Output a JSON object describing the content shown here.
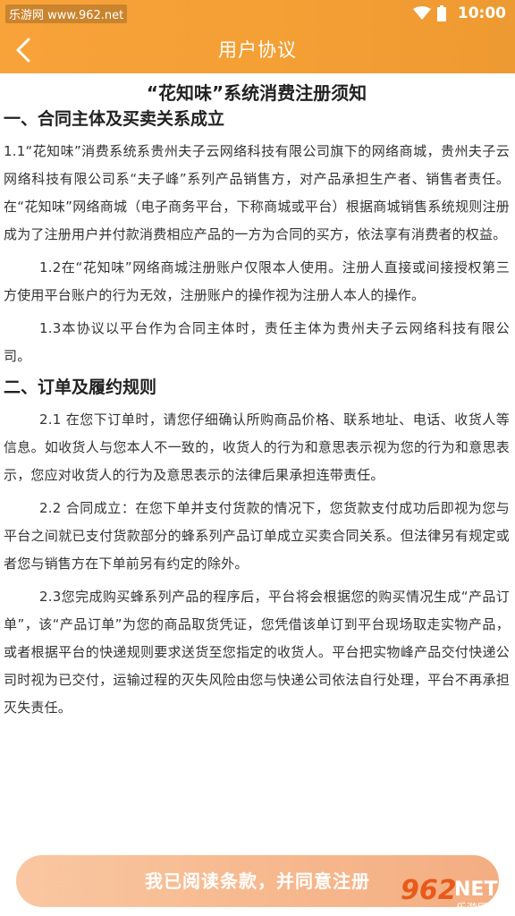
{
  "status_bar": {
    "watermark": "乐游网 www.962.net",
    "time": "10:00"
  },
  "header": {
    "title": "用户协议",
    "back_icon": "chevron-left-icon",
    "bg_color": "#f5a038"
  },
  "document": {
    "title": "“花知味”系统消费注册须知",
    "sections": [
      {
        "heading": "一、合同主体及买卖关系成立",
        "paragraphs": [
          "1.1“花知味”消费系统系贵州夫子云网络科技有限公司旗下的网络商城，贵州夫子云网络科技有限公司系“夫子峰”系列产品销售方，对产品承担生产者、销售者责任。在“花知味”网络商城（电子商务平台，下称商城或平台）根据商城销售系统规则注册成为了注册用户并付款消费相应产品的一方为合同的买方，依法享有消费者的权益。",
          "1.2在“花知味”网络商城注册账户仅限本人使用。注册人直接或间接授权第三方使用平台账户的行为无效，注册账户的操作视为注册人本人的操作。",
          "1.3本协议以平台作为合同主体时，责任主体为贵州夫子云网络科技有限公司。"
        ]
      },
      {
        "heading": "二、订单及履约规则",
        "paragraphs": [
          "2.1 在您下订单时，请您仔细确认所购商品价格、联系地址、电话、收货人等信息。如收货人与您本人不一致的，收货人的行为和意思表示视为您的行为和意思表示，您应对收货人的行为及意思表示的法律后果承担连带责任。",
          "2.2 合同成立：在您下单并支付货款的情况下，您货款支付成功后即视为您与平台之间就已支付货款部分的蜂系列产品订单成立买卖合同关系。但法律另有规定或者您与销售方在下单前另有约定的除外。",
          "2.3您完成购买蜂系列产品的程序后，平台将会根据您的购买情况生成“产品订单”，该“产品订单”为您的商品取货凭证，您凭借该单订到平台现场取走实物产品，或者根据平台的快递规则要求送货至您指定的收货人。平台把实物峰产品交付快递公司时视为已交付，运输过程的灭失风险由您与快递公司依法自行处理，平台不再承担灭失责任。"
        ]
      }
    ]
  },
  "footer": {
    "agree_label": "我已阅读条款，并同意注册",
    "button_color": "#f7b98e"
  },
  "watermark_bottom": {
    "num": "962",
    "net": "NET",
    "site": "乐游网"
  }
}
